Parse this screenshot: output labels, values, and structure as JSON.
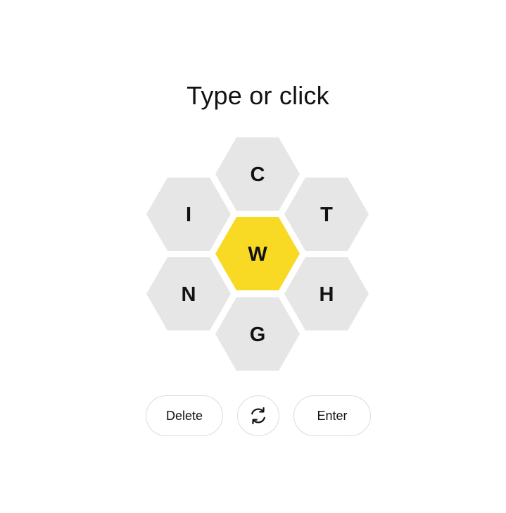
{
  "prompt": "Type or click",
  "hive": {
    "center_letter": "W",
    "outer_letters": [
      "C",
      "T",
      "H",
      "G",
      "N",
      "I"
    ],
    "colors": {
      "center": "#f8d924",
      "outer": "#e6e6e6"
    }
  },
  "controls": {
    "delete_label": "Delete",
    "shuffle_icon": "shuffle-icon",
    "enter_label": "Enter"
  }
}
